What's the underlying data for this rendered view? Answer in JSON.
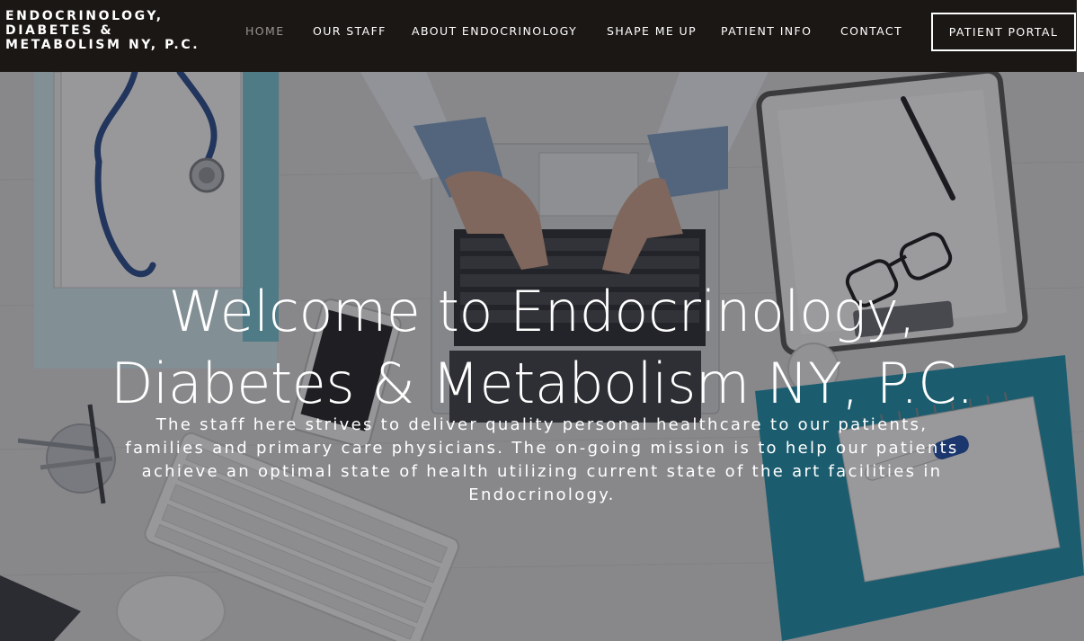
{
  "header": {
    "logo_lines": [
      "ENDOCRINOLOGY,",
      "DIABETES &",
      "METABOLISM NY, P.C."
    ],
    "nav": [
      {
        "label": "HOME",
        "active": true
      },
      {
        "label": "OUR STAFF",
        "active": false
      },
      {
        "label": "ABOUT ENDOCRINOLOGY",
        "active": false
      },
      {
        "label": "SHAPE ME UP",
        "active": false
      },
      {
        "label": "PATIENT INFO",
        "active": false
      },
      {
        "label": "CONTACT",
        "active": false
      }
    ],
    "portal_label": "PATIENT PORTAL"
  },
  "hero": {
    "title_lines": [
      "Welcome to Endocrinology,",
      "Diabetes & Metabolism NY, P.C."
    ],
    "text": "The staff here strives to deliver quality personal healthcare to our patients, families and primary care physicians. The on-going mission is to help our patients achieve an optimal state of health utilizing current state of the art facilities in Endocrinology."
  },
  "colors": {
    "header_bg": "#1b1715",
    "nav_active": "#9a948f",
    "text": "#ffffff",
    "folder_teal": "#1e8fa9"
  }
}
